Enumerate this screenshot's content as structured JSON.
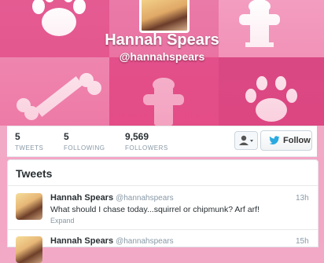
{
  "profile": {
    "name": "Hannah Spears",
    "handle": "@hannahspears"
  },
  "stats": [
    {
      "value": "5",
      "label": "TWEETS"
    },
    {
      "value": "5",
      "label": "FOLLOWING"
    },
    {
      "value": "9,569",
      "label": "FOLLOWERS"
    }
  ],
  "actions": {
    "follow_label": "Follow"
  },
  "tweets_panel": {
    "title": "Tweets",
    "items": [
      {
        "name": "Hannah Spears",
        "handle": "@hannahspears",
        "time": "13h",
        "text": "What should I chase today...squirrel or chipmunk? Arf arf!",
        "expand": "Expand"
      },
      {
        "name": "Hannah Spears",
        "handle": "@hannahspears",
        "time": "15h"
      }
    ]
  },
  "colors": {
    "accent_pink": "#e45b92",
    "twitter_blue": "#2aa9e0",
    "text_dark": "#292f33",
    "text_muted": "#8899a6"
  },
  "icons": {
    "paw": "paw-print-icon",
    "bone": "bone-icon",
    "hydrant": "fire-hydrant-icon",
    "person": "person-icon",
    "bird": "twitter-bird-icon"
  }
}
